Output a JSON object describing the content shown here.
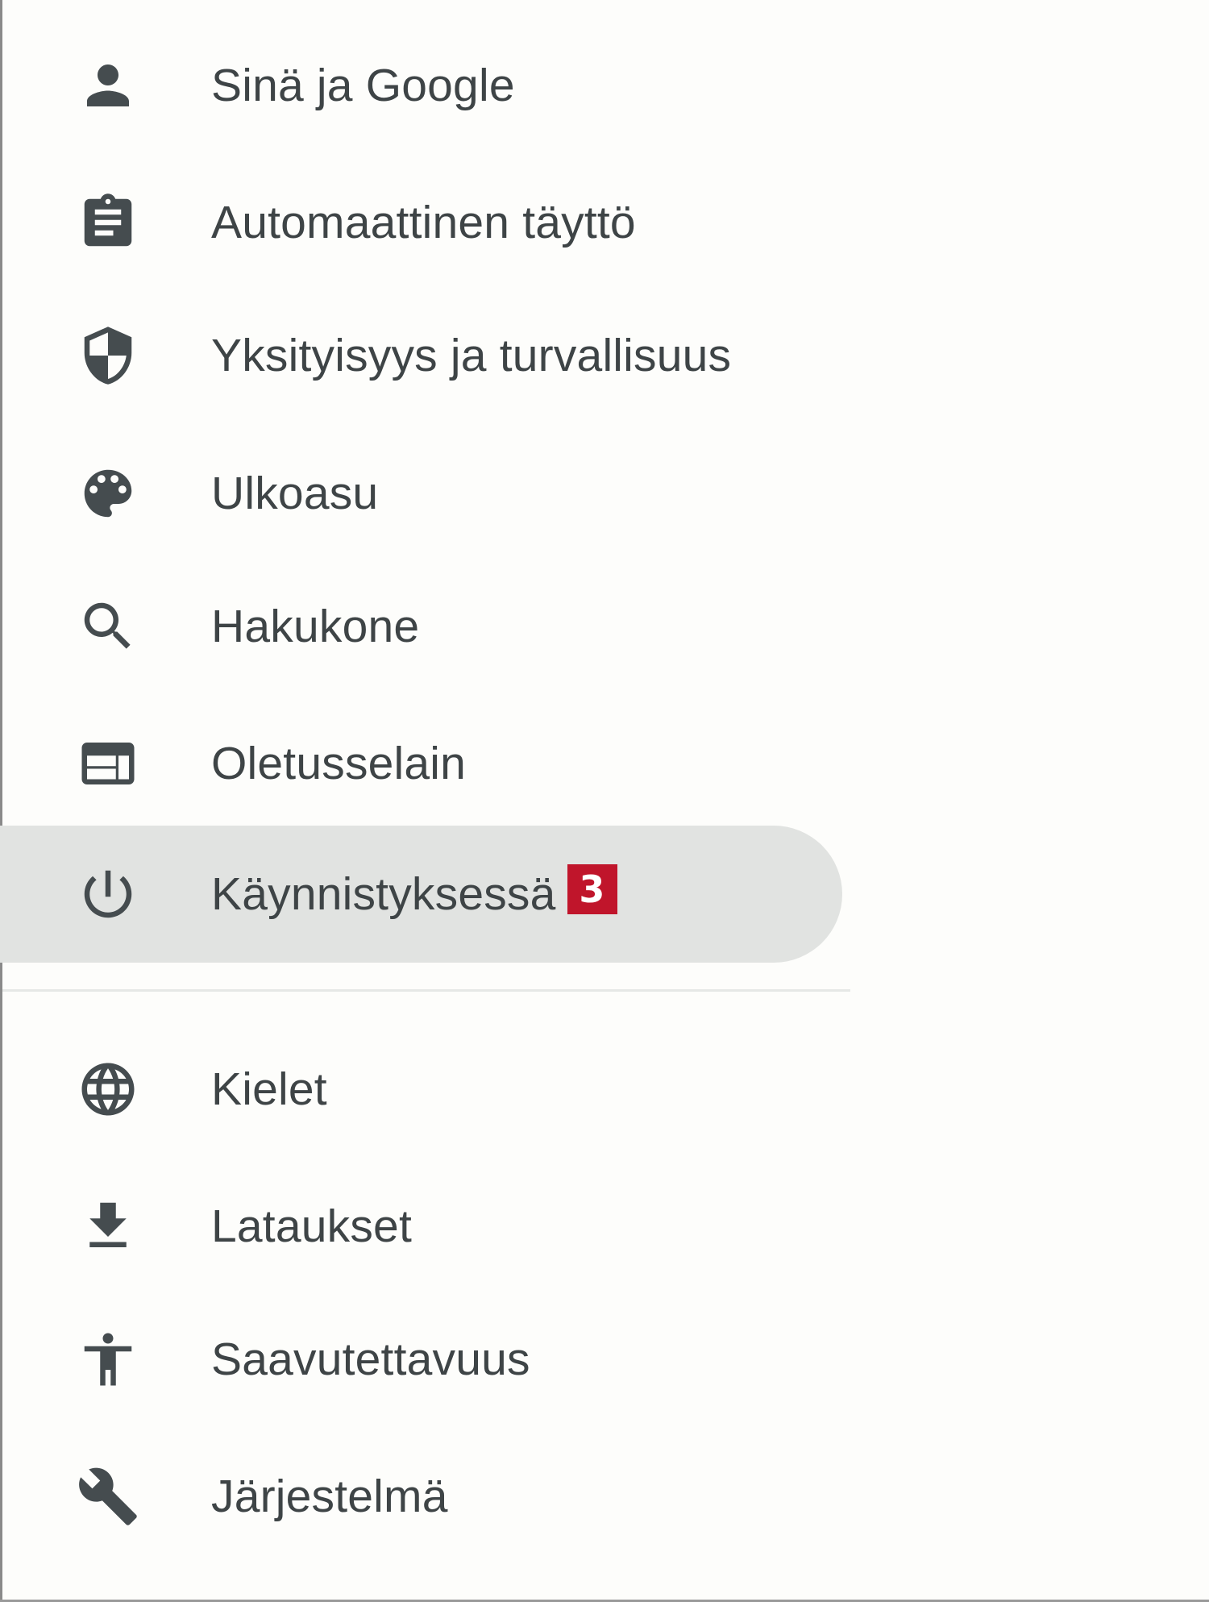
{
  "settings_menu": {
    "items": [
      {
        "label": "Sinä ja Google",
        "icon": "person-icon"
      },
      {
        "label": "Automaattinen täyttö",
        "icon": "clipboard-icon"
      },
      {
        "label": "Yksityisyys ja turvallisuus",
        "icon": "shield-icon"
      },
      {
        "label": "Ulkoasu",
        "icon": "palette-icon"
      },
      {
        "label": "Hakukone",
        "icon": "search-icon"
      },
      {
        "label": "Oletusselain",
        "icon": "browser-window-icon"
      },
      {
        "label": "Käynnistyksessä",
        "icon": "power-icon",
        "active": true,
        "badge": "3"
      },
      {
        "label": "Kielet",
        "icon": "globe-icon"
      },
      {
        "label": "Lataukset",
        "icon": "download-icon"
      },
      {
        "label": "Saavutettavuus",
        "icon": "accessibility-icon"
      },
      {
        "label": "Järjestelmä",
        "icon": "wrench-icon"
      }
    ]
  },
  "colors": {
    "background": "#fdfdfb",
    "active_item_background": "#e1e3e1",
    "icon": "#454c4f",
    "text": "#3e4446",
    "badge_background": "#c0152b",
    "badge_text": "#ffffff"
  }
}
